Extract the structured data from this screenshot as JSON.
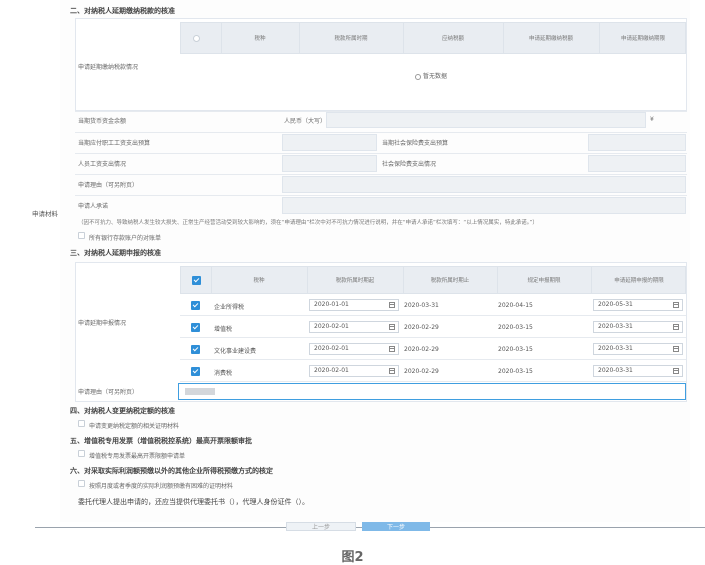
{
  "sections": {
    "s2_title": "二、对纳税人延期缴纳税款的核准",
    "s3_title": "三、对纳税人延期申报的核准",
    "s4_title": "四、对纳税人变更纳税定额的核准",
    "s5_title": "五、增值税专用发票（增值税税控系统）最高开票限额审批",
    "s6_title": "六、对采取实际利润额预缴以外的其他企业所得税预缴方式的核定"
  },
  "defer_payment": {
    "row_label": "申请延期缴纳税款情况",
    "columns": [
      "税种",
      "税款所属时期",
      "应纳税额",
      "申请延期缴纳税额",
      "申请延期缴纳期限"
    ],
    "empty_text": "暂无数据",
    "fields": {
      "monetary_balance": "当期货币资金余额",
      "currency_hint": "人民币（大写）",
      "currency_suffix": "¥",
      "wage_budget": "当期应付职工工资支出预算",
      "social_budget": "当期社会保险费支出预算",
      "wage_actual": "人员工资支出情况",
      "social_actual": "社会保险费支出情况",
      "reason": "申请理由（可另附页）",
      "commitment": "申请人承诺"
    },
    "note": "（因不可抗力、导致纳税人发生较大损失、正常生产经营活动受到较大影响的，须在“申请理由”栏次中对不可抗力情况进行说明，并在“申请人承诺”栏次填写：“以上情况属实，特此承诺。”）",
    "bank_checkbox": "所有银行存款账户的对账单"
  },
  "side_label": "申请材料",
  "defer_declaration": {
    "row_label": "申请延期申报情况",
    "columns": [
      "税种",
      "税款所属时期起",
      "税款所属时期止",
      "规定申报期限",
      "申请延期申报的期限"
    ],
    "rows": [
      {
        "tax": "企业所得税",
        "start": "2020-01-01",
        "end": "2020-03-31",
        "deadline": "2020-04-15",
        "extended": "2020-05-31"
      },
      {
        "tax": "增值税",
        "start": "2020-02-01",
        "end": "2020-02-29",
        "deadline": "2020-03-15",
        "extended": "2020-03-31"
      },
      {
        "tax": "文化事业建设费",
        "start": "2020-02-01",
        "end": "2020-02-29",
        "deadline": "2020-03-15",
        "extended": "2020-03-31"
      },
      {
        "tax": "消费税",
        "start": "2020-02-01",
        "end": "2020-02-29",
        "deadline": "2020-03-15",
        "extended": "2020-03-31"
      }
    ],
    "reason_label": "申请理由（可另附页）"
  },
  "s4_checkbox": "申请变更纳税定额的相关证明材料",
  "s5_checkbox": "增值税专用发票最高开票限额申请单",
  "s6_checkbox": "按照月度或者季度的实际利润额预缴有困难的证明材料",
  "agent_line": "委托代理人提出申请的，还应当提供代理委托书（），代理人身份证件（）。",
  "buttons": {
    "prev": "上一步",
    "next": "下一步"
  },
  "caption": "图2",
  "colors": {
    "accent": "#2f8fd8",
    "header_bg": "#e9edf2",
    "readonly_bg": "#eef1f4"
  }
}
